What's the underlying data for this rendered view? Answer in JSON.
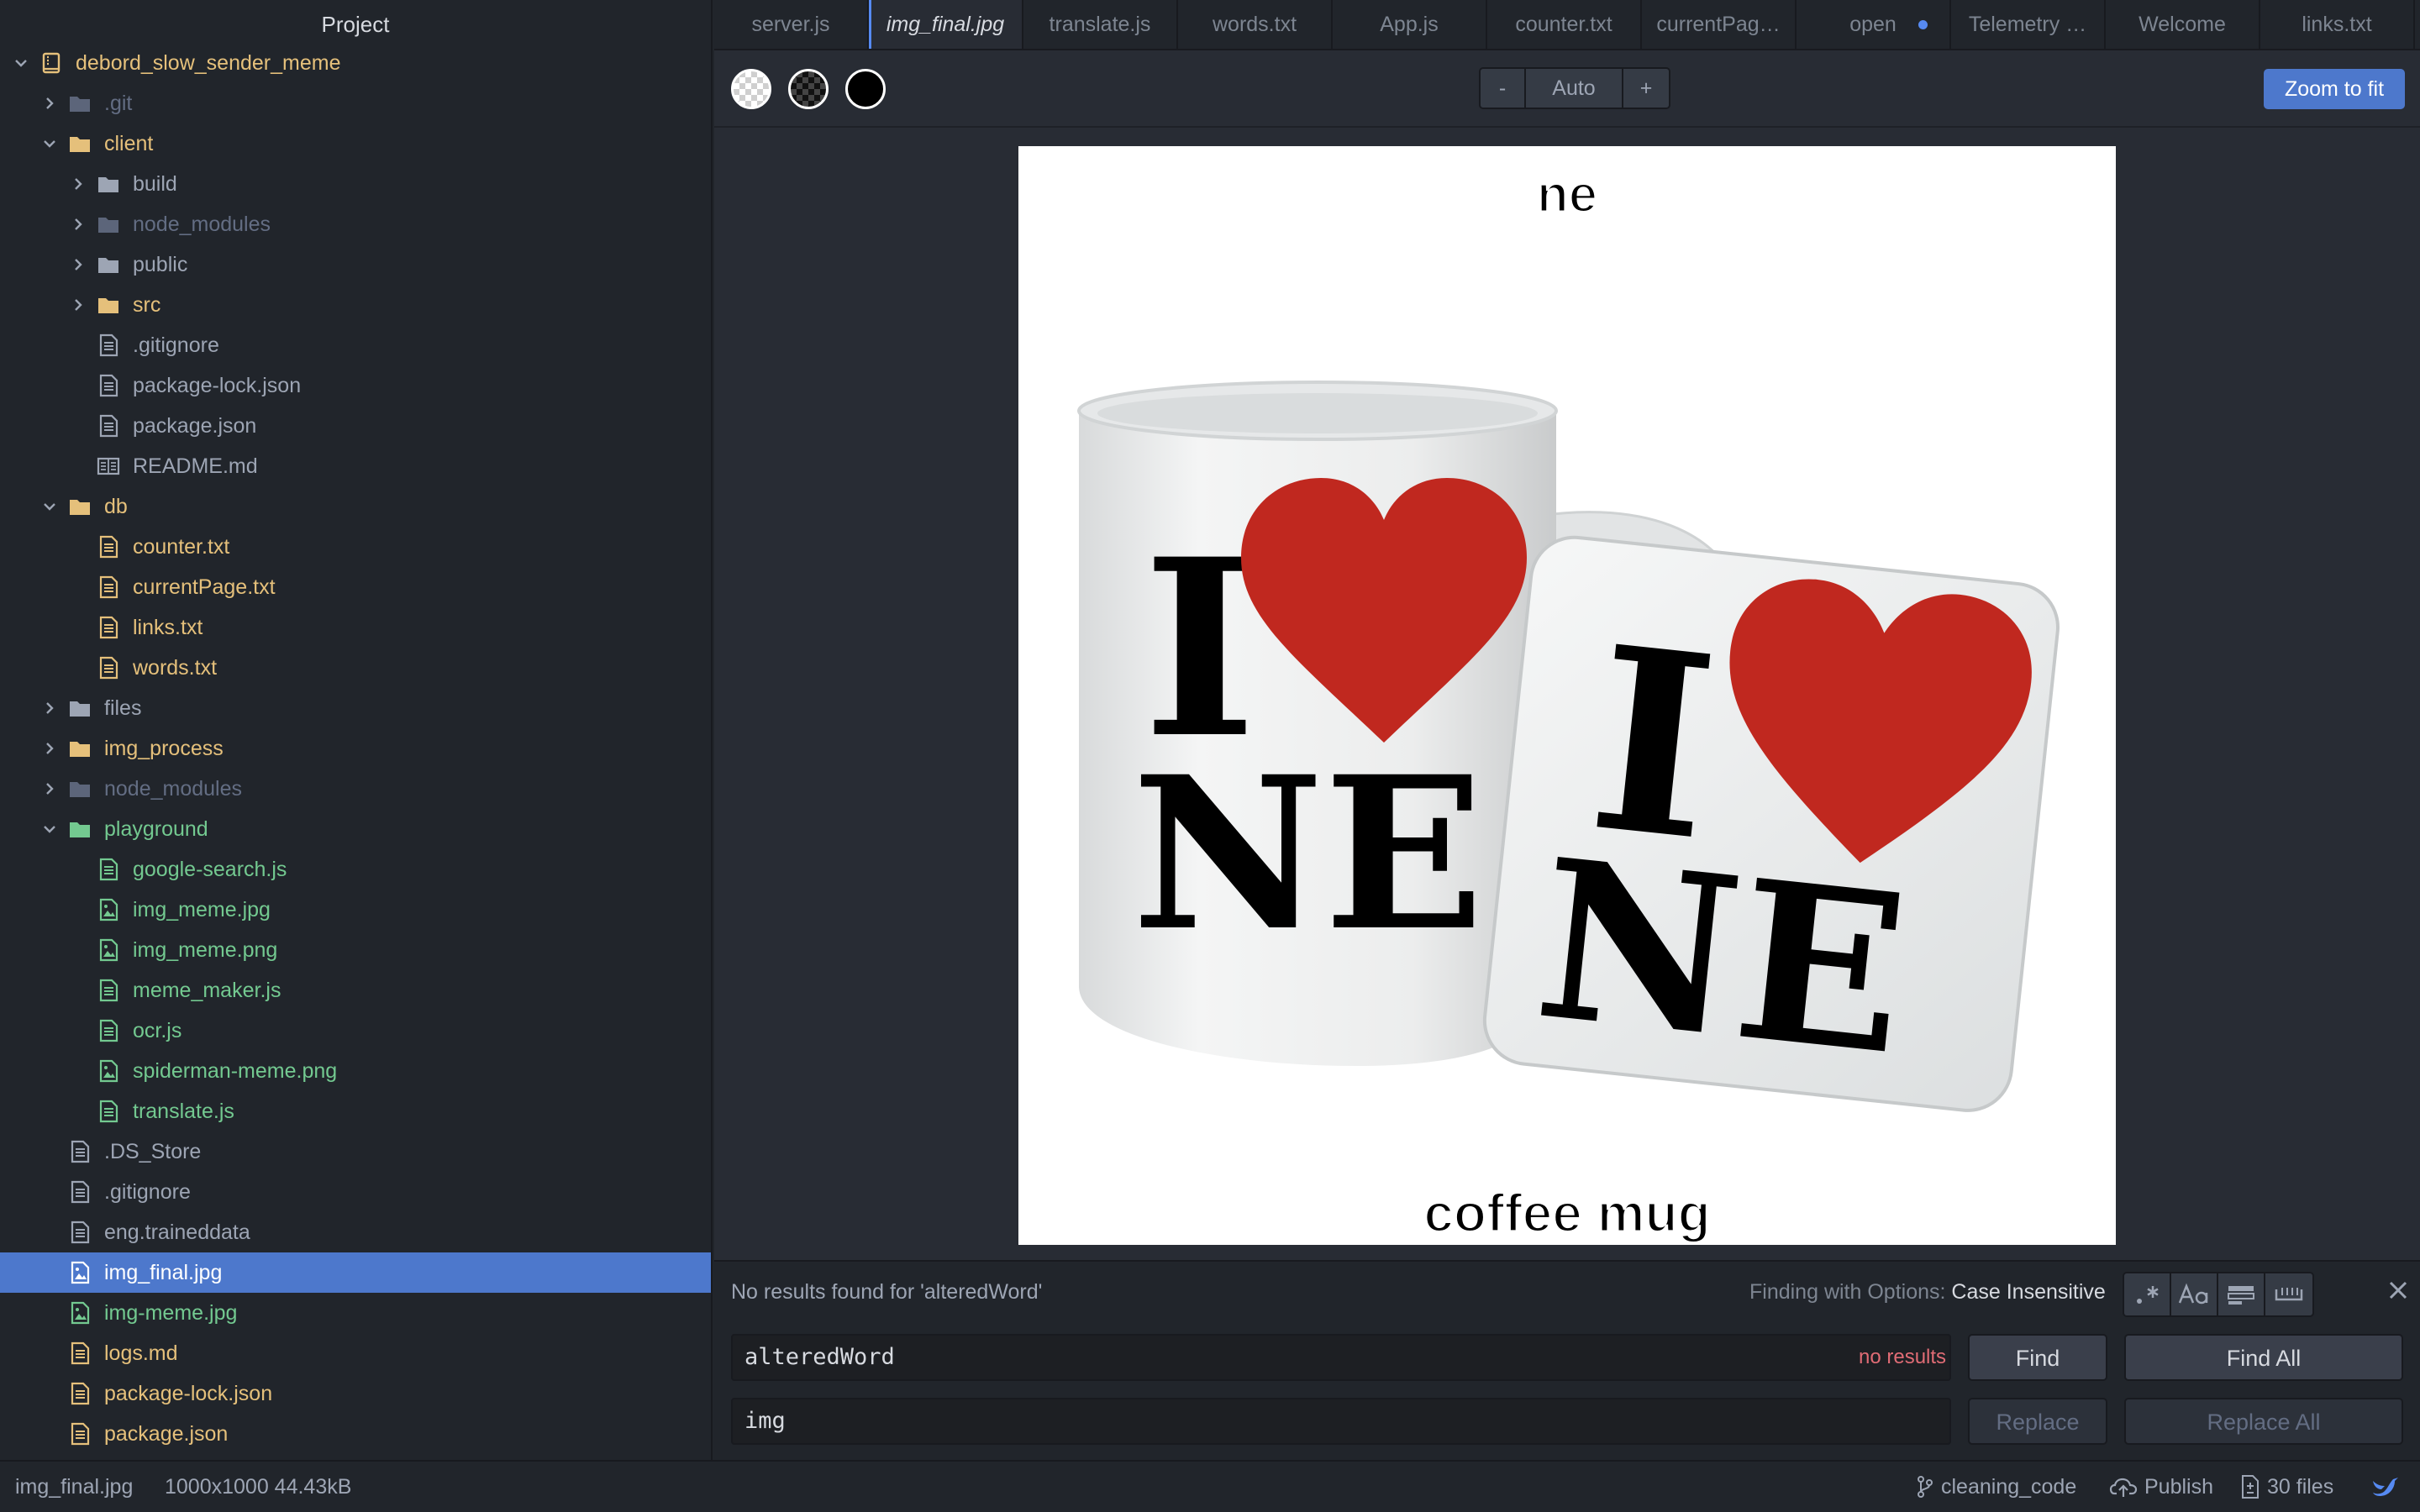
{
  "sidebar": {
    "title": "Project",
    "tree": [
      {
        "label": "debord_slow_sender_meme",
        "kind": "project",
        "depth": 0,
        "expanded": true,
        "color": "project"
      },
      {
        "label": ".git",
        "kind": "folder",
        "depth": 1,
        "expanded": false,
        "color": "ignored"
      },
      {
        "label": "client",
        "kind": "folder",
        "depth": 1,
        "expanded": true,
        "color": "modified"
      },
      {
        "label": "build",
        "kind": "folder",
        "depth": 2,
        "expanded": false,
        "color": "default"
      },
      {
        "label": "node_modules",
        "kind": "folder",
        "depth": 2,
        "expanded": false,
        "color": "ignored"
      },
      {
        "label": "public",
        "kind": "folder",
        "depth": 2,
        "expanded": false,
        "color": "default"
      },
      {
        "label": "src",
        "kind": "folder",
        "depth": 2,
        "expanded": false,
        "color": "modified"
      },
      {
        "label": ".gitignore",
        "kind": "file",
        "depth": 2,
        "color": "default"
      },
      {
        "label": "package-lock.json",
        "kind": "file",
        "depth": 2,
        "color": "default"
      },
      {
        "label": "package.json",
        "kind": "file",
        "depth": 2,
        "color": "default"
      },
      {
        "label": "README.md",
        "kind": "book",
        "depth": 2,
        "color": "default"
      },
      {
        "label": "db",
        "kind": "folder",
        "depth": 1,
        "expanded": true,
        "color": "modified"
      },
      {
        "label": "counter.txt",
        "kind": "file",
        "depth": 2,
        "color": "modified"
      },
      {
        "label": "currentPage.txt",
        "kind": "file",
        "depth": 2,
        "color": "modified"
      },
      {
        "label": "links.txt",
        "kind": "file",
        "depth": 2,
        "color": "modified"
      },
      {
        "label": "words.txt",
        "kind": "file",
        "depth": 2,
        "color": "modified"
      },
      {
        "label": "files",
        "kind": "folder",
        "depth": 1,
        "expanded": false,
        "color": "default"
      },
      {
        "label": "img_process",
        "kind": "folder",
        "depth": 1,
        "expanded": false,
        "color": "modified"
      },
      {
        "label": "node_modules",
        "kind": "folder",
        "depth": 1,
        "expanded": false,
        "color": "ignored"
      },
      {
        "label": "playground",
        "kind": "folder",
        "depth": 1,
        "expanded": true,
        "color": "added"
      },
      {
        "label": "google-search.js",
        "kind": "file",
        "depth": 2,
        "color": "added"
      },
      {
        "label": "img_meme.jpg",
        "kind": "image",
        "depth": 2,
        "color": "added"
      },
      {
        "label": "img_meme.png",
        "kind": "image",
        "depth": 2,
        "color": "added"
      },
      {
        "label": "meme_maker.js",
        "kind": "file",
        "depth": 2,
        "color": "added"
      },
      {
        "label": "ocr.js",
        "kind": "file",
        "depth": 2,
        "color": "added"
      },
      {
        "label": "spiderman-meme.png",
        "kind": "image",
        "depth": 2,
        "color": "added"
      },
      {
        "label": "translate.js",
        "kind": "file",
        "depth": 2,
        "color": "added"
      },
      {
        "label": ".DS_Store",
        "kind": "file",
        "depth": 1,
        "color": "default"
      },
      {
        "label": ".gitignore",
        "kind": "file",
        "depth": 1,
        "color": "default"
      },
      {
        "label": "eng.traineddata",
        "kind": "file",
        "depth": 1,
        "color": "default"
      },
      {
        "label": "img_final.jpg",
        "kind": "image",
        "depth": 1,
        "color": "selected",
        "selected": true
      },
      {
        "label": "img-meme.jpg",
        "kind": "image",
        "depth": 1,
        "color": "added"
      },
      {
        "label": "logs.md",
        "kind": "file",
        "depth": 1,
        "color": "modified"
      },
      {
        "label": "package-lock.json",
        "kind": "file",
        "depth": 1,
        "color": "modified"
      },
      {
        "label": "package.json",
        "kind": "file",
        "depth": 1,
        "color": "modified"
      }
    ]
  },
  "tabs": [
    {
      "label": "server.js",
      "active": false,
      "modified": false
    },
    {
      "label": "img_final.jpg",
      "active": true,
      "modified": false
    },
    {
      "label": "translate.js",
      "active": false,
      "modified": false
    },
    {
      "label": "words.txt",
      "active": false,
      "modified": false
    },
    {
      "label": "App.js",
      "active": false,
      "modified": false
    },
    {
      "label": "counter.txt",
      "active": false,
      "modified": false
    },
    {
      "label": "currentPag…",
      "active": false,
      "modified": false
    },
    {
      "label": "open",
      "active": false,
      "modified": true
    },
    {
      "label": "Telemetry …",
      "active": false,
      "modified": false
    },
    {
      "label": "Welcome",
      "active": false,
      "modified": false
    },
    {
      "label": "links.txt",
      "active": false,
      "modified": false
    }
  ],
  "image_view": {
    "zoom_minus": "-",
    "zoom_level": "Auto",
    "zoom_plus": "+",
    "zoom_to_fit": "Zoom to fit",
    "meme": {
      "top_text": "ne",
      "bottom_text": "coffee mug",
      "mug_print_i": "I",
      "mug_print_ne": "NE",
      "coaster_print_i": "I",
      "coaster_print_ne": "NE",
      "heart_color": "#c0281f"
    }
  },
  "find_replace": {
    "description": "No results found for 'alteredWord'",
    "options_prefix": "Finding with Options:",
    "options_value": "Case Insensitive",
    "find_value": "alteredWord",
    "result_count": "no results",
    "replace_value": "img",
    "find_button": "Find",
    "find_all_button": "Find All",
    "replace_button": "Replace",
    "replace_all_button": "Replace All",
    "toggle_icons": [
      "regex-icon",
      "case-sensitive-icon",
      "in-selection-icon",
      "whole-word-icon"
    ]
  },
  "status_bar": {
    "file_name": "img_final.jpg",
    "image_info": "1000x1000 44.43kB",
    "branch": "cleaning_code",
    "publish": "Publish",
    "file_count": "30 files"
  },
  "colors": {
    "accent": "#4d78cc",
    "modified": "#e5c07b",
    "added": "#73c990",
    "ignored": "#636d83",
    "error": "#e06c75"
  }
}
